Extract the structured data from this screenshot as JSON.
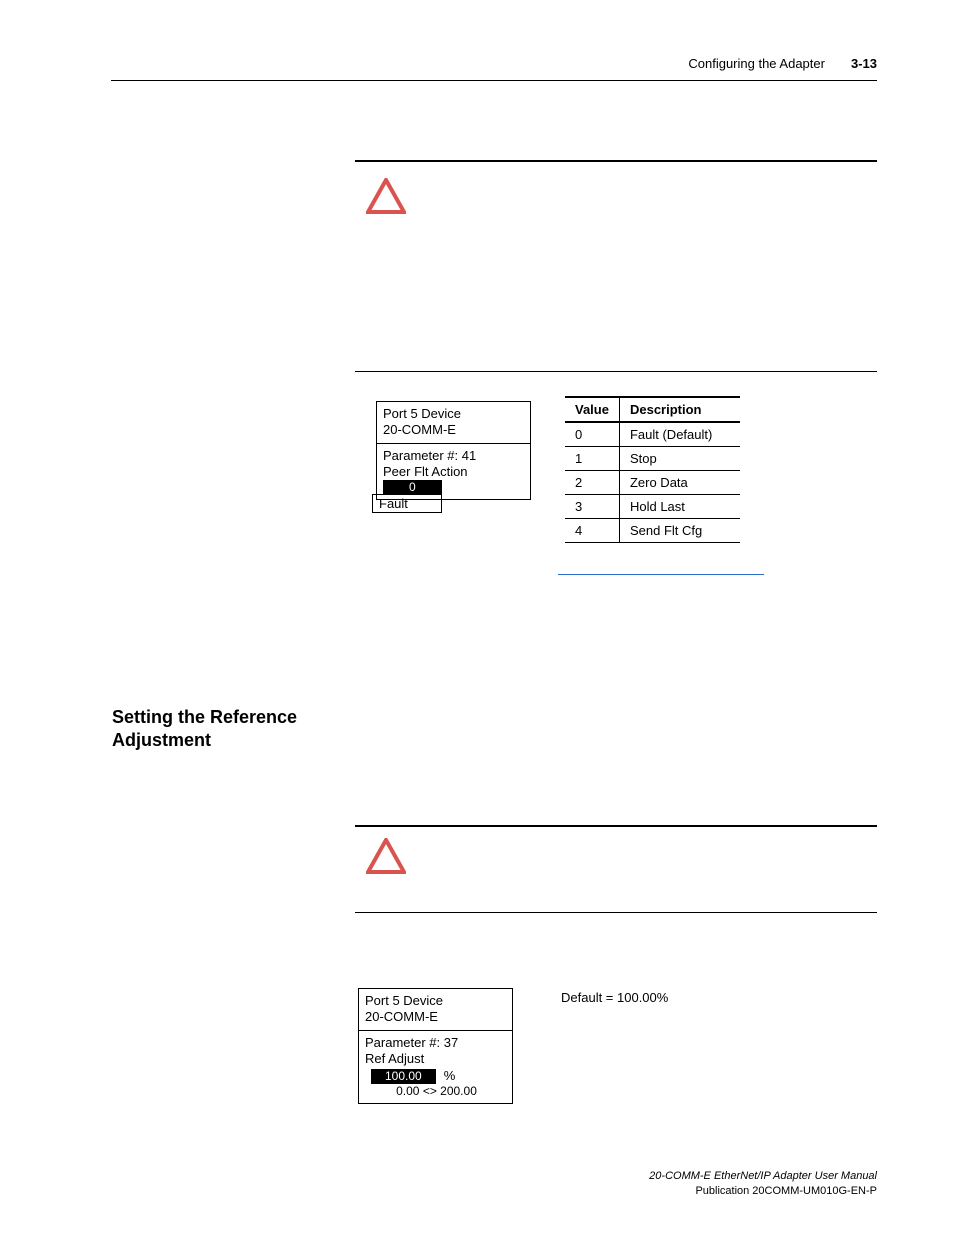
{
  "header": {
    "section_title": "Configuring the Adapter",
    "page_number": "3-13"
  },
  "him1": {
    "port_line": "Port 5 Device",
    "model_line": "20-COMM-E",
    "param_line": "Parameter #: 41",
    "name_line": "Peer Flt Action",
    "value": "0",
    "status": "Fault"
  },
  "value_table": {
    "headers": {
      "col1": "Value",
      "col2": "Description"
    },
    "rows": [
      {
        "v": "0",
        "d": "Fault (Default)"
      },
      {
        "v": "1",
        "d": "Stop"
      },
      {
        "v": "2",
        "d": "Zero Data"
      },
      {
        "v": "3",
        "d": "Hold Last"
      },
      {
        "v": "4",
        "d": "Send Flt Cfg"
      }
    ]
  },
  "section": {
    "heading": "Setting the Reference Adjustment"
  },
  "him2": {
    "port_line": "Port 5 Device",
    "model_line": "20-COMM-E",
    "param_line": "Parameter #: 37",
    "name_line": "Ref Adjust",
    "value": "100.00",
    "unit": "%",
    "range": "0.00 <> 200.00"
  },
  "default_text": "Default = 100.00%",
  "footer": {
    "manual": "20-COMM-E EtherNet/IP Adapter User Manual",
    "pub": "Publication 20COMM-UM010G-EN-P"
  }
}
